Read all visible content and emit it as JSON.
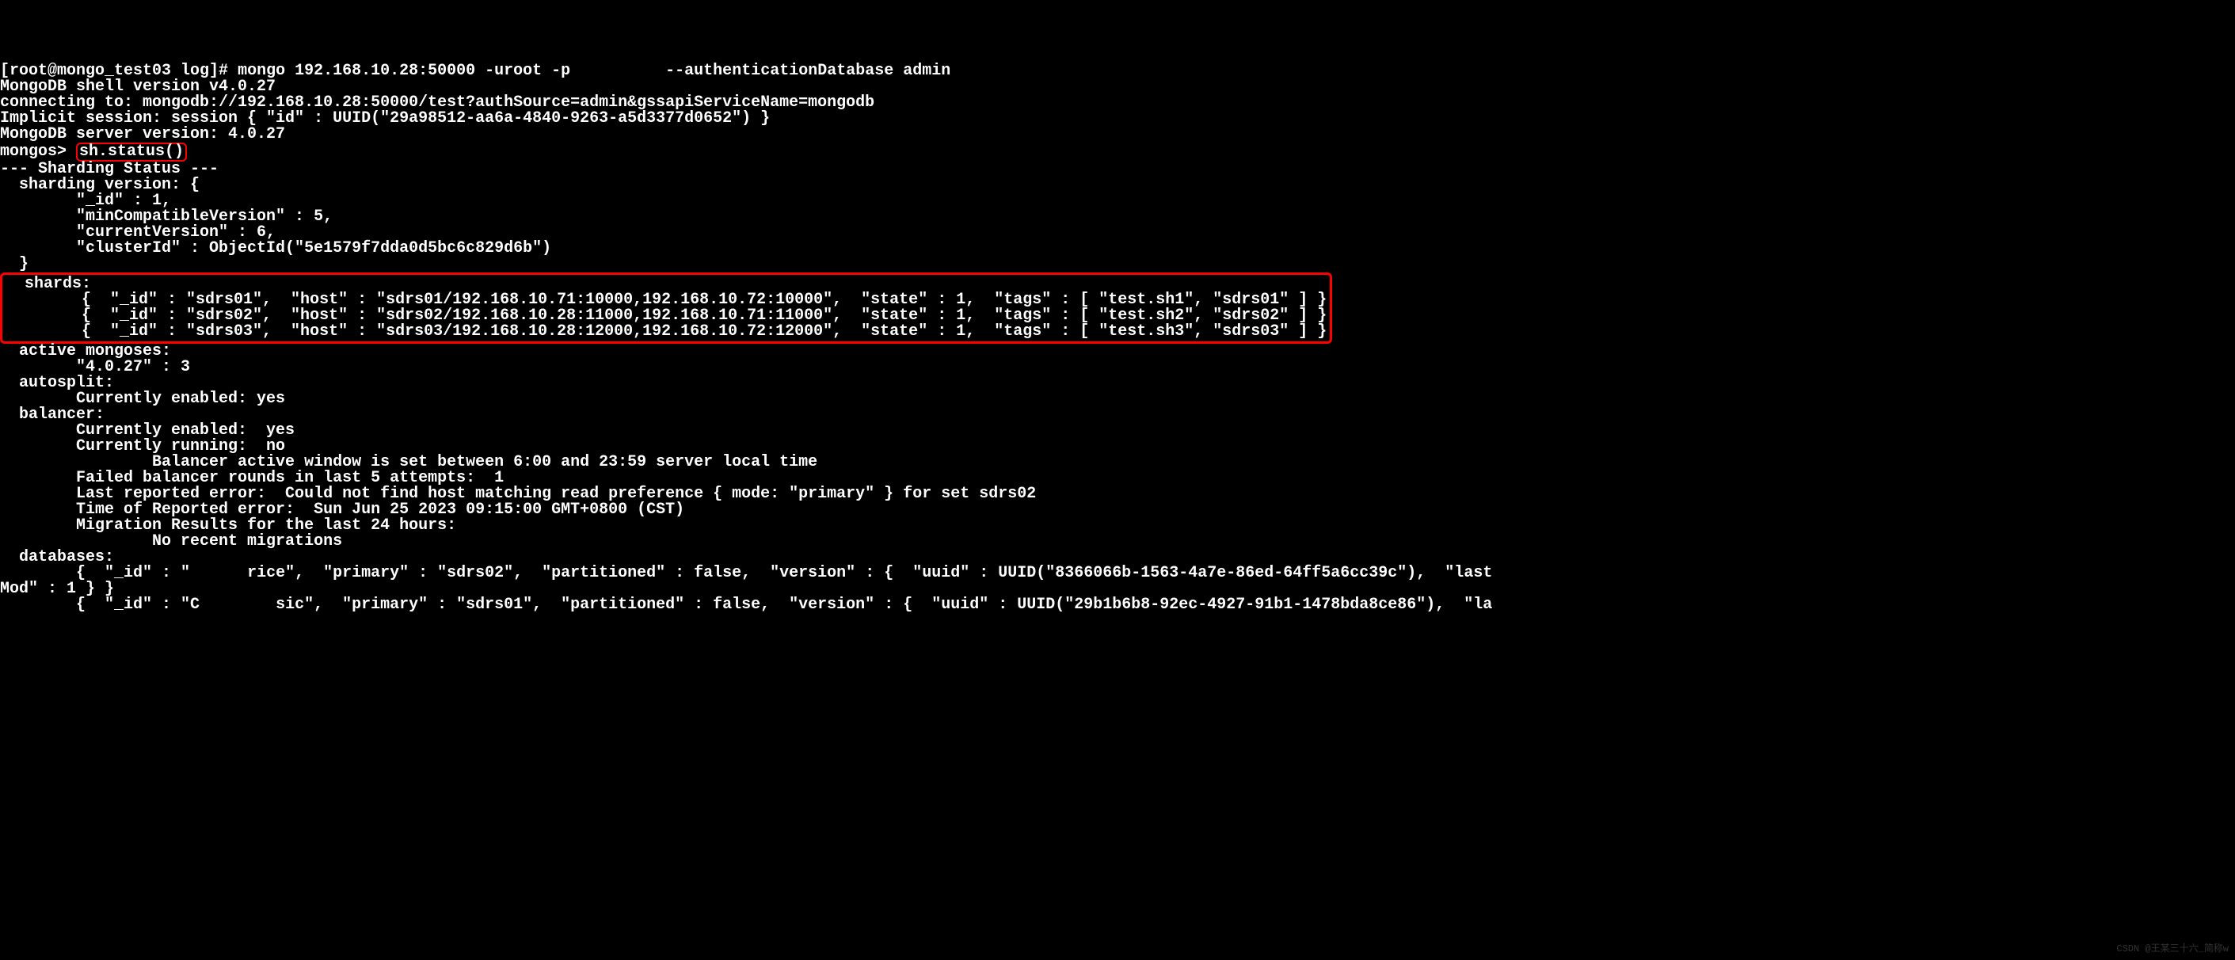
{
  "header": {
    "prompt": "[root@mongo_test03 log]# ",
    "cmd": "mongo 192.168.10.28:50000 -uroot -p",
    "cmd_redacted": "*********",
    "cmd_tail": " --authenticationDatabase admin",
    "shell_version": "MongoDB shell version v4.0.27",
    "connecting": "connecting to: mongodb://192.168.10.28:50000/test?authSource=admin&gssapiServiceName=mongodb",
    "implicit_session": "Implicit session: session { \"id\" : UUID(\"29a98512-aa6a-4840-9263-a5d3377d0652\") }",
    "server_version": "MongoDB server version: 4.0.27",
    "mongos_prompt": "mongos> ",
    "sh_cmd": "sh.status()"
  },
  "status": {
    "title": "--- Sharding Status ---",
    "sharding_version_open": "  sharding version: {",
    "sv_id": "        \"_id\" : 1,",
    "sv_mincompat": "        \"minCompatibleVersion\" : 5,",
    "sv_current": "        \"currentVersion\" : 6,",
    "sv_clusterid": "        \"clusterId\" : ObjectId(\"5e1579f7dda0d5bc6c829d6b\")",
    "sharding_version_close": "  }",
    "shards_label": "  shards:",
    "shards": [
      "        {  \"_id\" : \"sdrs01\",  \"host\" : \"sdrs01/192.168.10.71:10000,192.168.10.72:10000\",  \"state\" : 1,  \"tags\" : [ \"test.sh1\", \"sdrs01\" ] }",
      "        {  \"_id\" : \"sdrs02\",  \"host\" : \"sdrs02/192.168.10.28:11000,192.168.10.71:11000\",  \"state\" : 1,  \"tags\" : [ \"test.sh2\", \"sdrs02\" ] }",
      "        {  \"_id\" : \"sdrs03\",  \"host\" : \"sdrs03/192.168.10.28:12000,192.168.10.72:12000\",  \"state\" : 1,  \"tags\" : [ \"test.sh3\", \"sdrs03\" ] }"
    ],
    "active_mongoses": "  active mongoses:",
    "active_mongoses_val": "        \"4.0.27\" : 3",
    "autosplit": "  autosplit:",
    "autosplit_val": "        Currently enabled: yes",
    "balancer": "  balancer:",
    "bal_enabled": "        Currently enabled:  yes",
    "bal_running": "        Currently running:  no",
    "bal_window": "                Balancer active window is set between 6:00 and 23:59 server local time",
    "bal_failed": "        Failed balancer rounds in last 5 attempts:  1",
    "bal_error": "        Last reported error:  Could not find host matching read preference { mode: \"primary\" } for set sdrs02",
    "bal_time": "        Time of Reported error:  Sun Jun 25 2023 09:15:00 GMT+0800 (CST)",
    "migration_header": "        Migration Results for the last 24 hours:",
    "migration_val": "                No recent migrations",
    "databases_label": "  databases:",
    "db1_pre": "        {  \"_id\" : \"",
    "db1_hidden": "      ",
    "db1_post": "rice\",  \"primary\" : \"sdrs02\",  \"partitioned\" : false,  \"version\" : {  \"uuid\" : UUID(\"8366066b-1563-4a7e-86ed-64ff5a6cc39c\"),  \"last",
    "db1_cont": "Mod\" : 1 } }",
    "db2_pre": "        {  \"_id\" : \"C",
    "db2_hidden": "        ",
    "db2_post": "sic\",  \"primary\" : \"sdrs01\",  \"partitioned\" : false,  \"version\" : {  \"uuid\" : UUID(\"29b1b6b8-92ec-4927-91b1-1478bda8ce86\"),  \"la"
  },
  "watermark": "CSDN @王某三十六_简称w"
}
